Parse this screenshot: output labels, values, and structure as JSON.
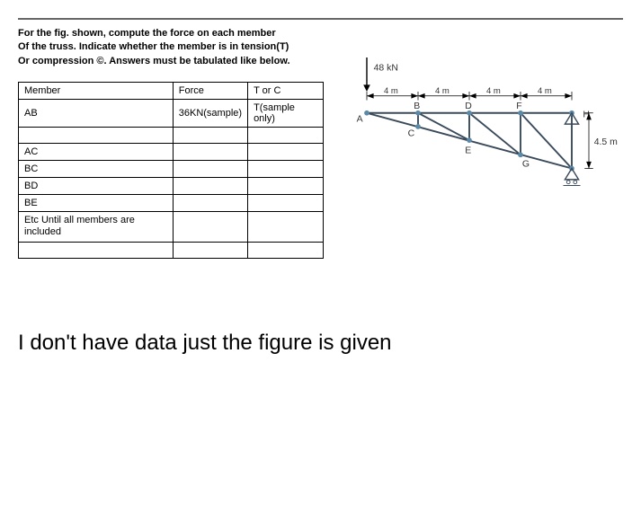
{
  "question": {
    "line1": "For the fig. shown, compute the force on each member",
    "line2": "Of the truss. Indicate whether the member is in tension(T)",
    "line3": "Or compression ©. Answers must be tabulated like below."
  },
  "table": {
    "headers": {
      "col1": "Member",
      "col2": "Force",
      "col3": "T or C"
    },
    "rows": [
      {
        "member": "AB",
        "force": "36KN(sample)",
        "tc": "T(sample only)"
      },
      {
        "member": "",
        "force": "",
        "tc": ""
      },
      {
        "member": "AC",
        "force": "",
        "tc": ""
      },
      {
        "member": "BC",
        "force": "",
        "tc": ""
      },
      {
        "member": "BD",
        "force": "",
        "tc": ""
      },
      {
        "member": "BE",
        "force": "",
        "tc": ""
      },
      {
        "member": "Etc Until all members are included",
        "force": "",
        "tc": ""
      },
      {
        "member": "",
        "force": "",
        "tc": ""
      }
    ]
  },
  "figure": {
    "load": "48 kN",
    "dim1": "4 m",
    "dim2": "4 m",
    "dim3": "4 m",
    "dim4": "4 m",
    "labelA": "A",
    "labelB": "B",
    "labelC": "C",
    "labelD": "D",
    "labelE": "E",
    "labelF": "F",
    "labelG": "G",
    "labelH": "H",
    "height": "4.5 m"
  },
  "bottomNote": "I don't have data just the figure is given"
}
